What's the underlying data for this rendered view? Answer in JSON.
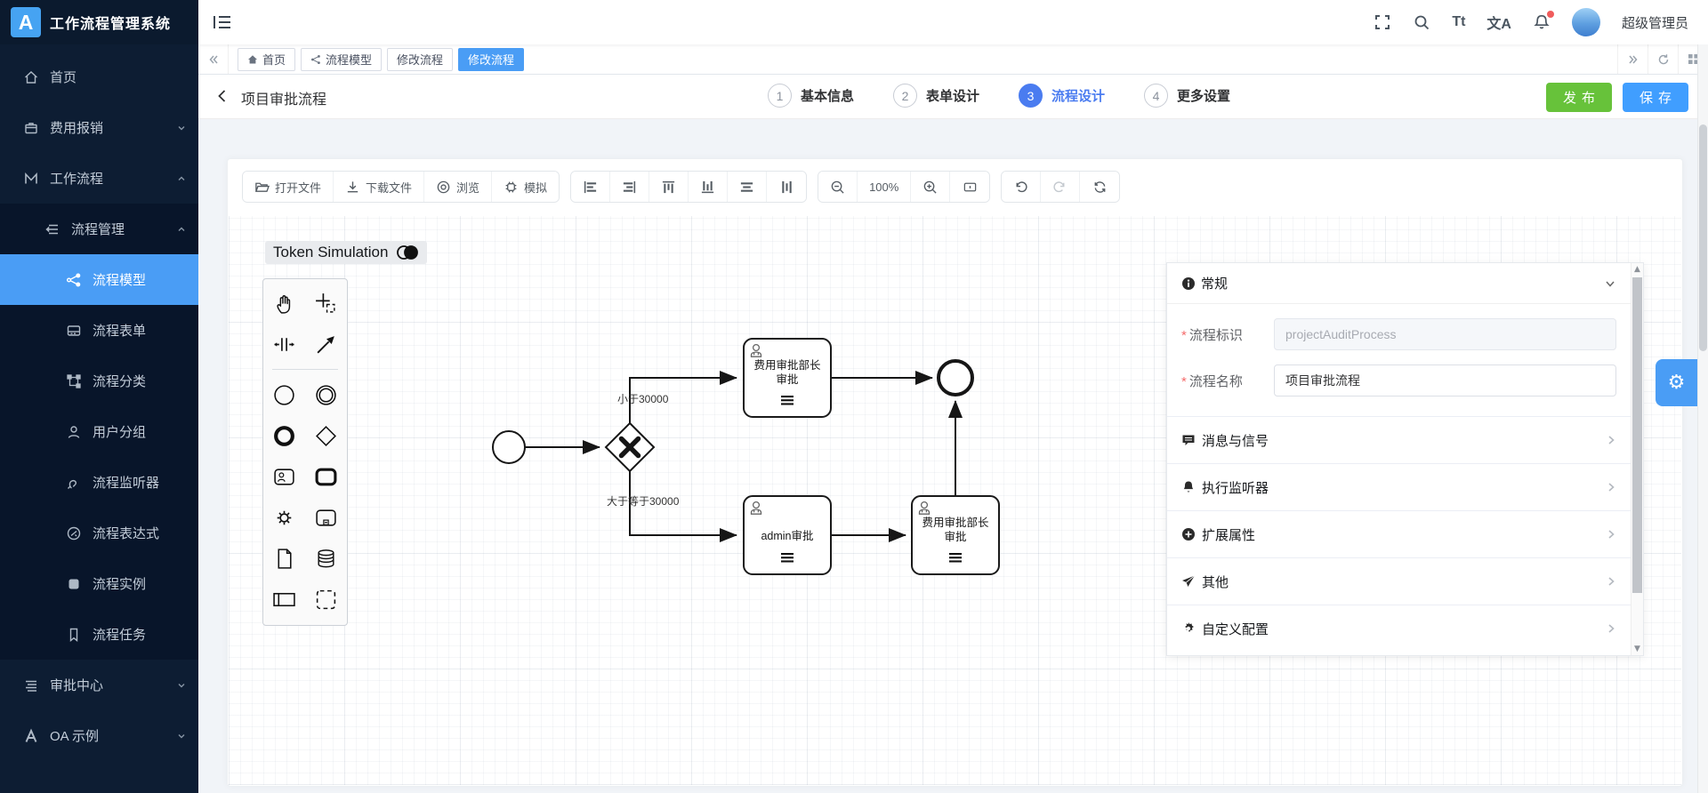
{
  "app": {
    "logo_letter": "A",
    "title": "工作流程管理系统",
    "user": "超级管理员"
  },
  "header": {
    "font_icon": "Tt",
    "lang_icon": "文A"
  },
  "sidebar": {
    "items": [
      {
        "label": "首页"
      },
      {
        "label": "费用报销"
      },
      {
        "label": "工作流程"
      },
      {
        "label": "流程管理"
      },
      {
        "label": "流程模型"
      },
      {
        "label": "流程表单"
      },
      {
        "label": "流程分类"
      },
      {
        "label": "用户分组"
      },
      {
        "label": "流程监听器"
      },
      {
        "label": "流程表达式"
      },
      {
        "label": "流程实例"
      },
      {
        "label": "流程任务"
      },
      {
        "label": "审批中心"
      },
      {
        "label": "OA 示例"
      }
    ]
  },
  "tabs": {
    "items": [
      {
        "label": "首页"
      },
      {
        "label": "流程模型"
      },
      {
        "label": "修改流程"
      },
      {
        "label": "修改流程"
      }
    ]
  },
  "page": {
    "title": "项目审批流程",
    "publish_label": "发布",
    "save_label": "保存",
    "steps": [
      {
        "num": "1",
        "label": "基本信息"
      },
      {
        "num": "2",
        "label": "表单设计"
      },
      {
        "num": "3",
        "label": "流程设计"
      },
      {
        "num": "4",
        "label": "更多设置"
      }
    ]
  },
  "toolbar": {
    "open": "打开文件",
    "download": "下载文件",
    "preview": "浏览",
    "simulate": "模拟",
    "zoom": "100%"
  },
  "canvas": {
    "token_simulation": "Token Simulation"
  },
  "diagram": {
    "tasks": [
      {
        "line1": "费用审批部长",
        "line2": "审批"
      },
      {
        "line1": "admin审批"
      },
      {
        "line1": "费用审批部长",
        "line2": "审批"
      }
    ],
    "edge_labels": [
      "小于30000",
      "大于等于30000"
    ]
  },
  "panel": {
    "required_mark": "*",
    "toggle_icon": "⚙",
    "general": {
      "title": "常规",
      "fields": [
        {
          "label": "流程标识",
          "value": "projectAuditProcess"
        },
        {
          "label": "流程名称",
          "value": "项目审批流程"
        }
      ]
    },
    "sections": [
      {
        "label": "消息与信号"
      },
      {
        "label": "执行监听器"
      },
      {
        "label": "扩展属性"
      },
      {
        "label": "其他"
      },
      {
        "label": "自定义配置"
      }
    ]
  },
  "colors": {
    "primary": "#409eff",
    "tab_active": "#4a9df5",
    "publish_green": "#67c23a",
    "step_active": "#4a7cf0",
    "sidebar_bg": "#0d1d33"
  }
}
